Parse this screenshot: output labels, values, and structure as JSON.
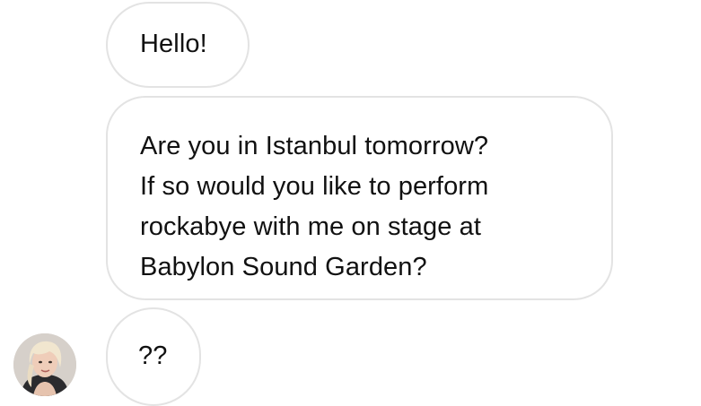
{
  "messages": [
    {
      "text": "Hello!"
    },
    {
      "lines": [
        "Are you in Istanbul tomorrow?",
        "If so would you like to perform",
        "rockabye with me on stage at",
        "Babylon Sound Garden?"
      ]
    },
    {
      "text": "??"
    }
  ],
  "sender": {
    "avatar_icon": "user-avatar-icon"
  },
  "colors": {
    "background": "#ffffff",
    "bubble_border": "#e3e3e3",
    "text": "#111111"
  }
}
